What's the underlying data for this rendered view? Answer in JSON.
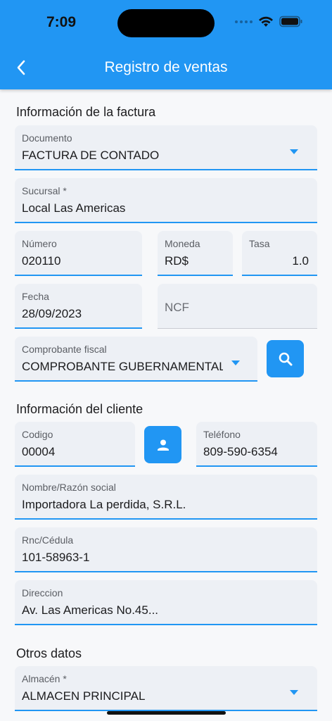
{
  "status": {
    "time": "7:09"
  },
  "header": {
    "title": "Registro de ventas"
  },
  "sections": {
    "factura": "Información de la factura",
    "cliente": "Información del cliente",
    "otros": "Otros datos"
  },
  "fields": {
    "documento": {
      "label": "Documento",
      "value": "FACTURA DE CONTADO"
    },
    "sucursal": {
      "label": "Sucursal *",
      "value": "Local Las Americas"
    },
    "numero": {
      "label": "Número",
      "value": "020110"
    },
    "moneda": {
      "label": "Moneda",
      "value": "RD$"
    },
    "tasa": {
      "label": "Tasa",
      "value": "1.0"
    },
    "fecha": {
      "label": "Fecha",
      "value": "28/09/2023"
    },
    "ncf": {
      "placeholder": "NCF"
    },
    "comprobante": {
      "label": "Comprobante fiscal",
      "value": "COMPROBANTE GUBERNAMENTAL"
    },
    "codigo": {
      "label": "Codigo",
      "value": "00004"
    },
    "telefono": {
      "label": "Teléfono",
      "value": "809-590-6354"
    },
    "nombre": {
      "label": "Nombre/Razón social",
      "value": "Importadora La perdida, S.R.L."
    },
    "rnc": {
      "label": "Rnc/Cédula",
      "value": "101-58963-1"
    },
    "direccion": {
      "label": "Direccion",
      "value": "Av. Las Americas No.45..."
    },
    "almacen": {
      "label": "Almacén *",
      "value": "ALMACEN PRINCIPAL"
    }
  },
  "icons": {
    "back": "chevron-left-icon",
    "search": "search-icon",
    "person": "person-icon",
    "dropdown": "dropdown-arrow-icon"
  },
  "colors": {
    "primary": "#2196f3",
    "field_bg": "#edf0f5",
    "background": "#f7f8fa"
  }
}
